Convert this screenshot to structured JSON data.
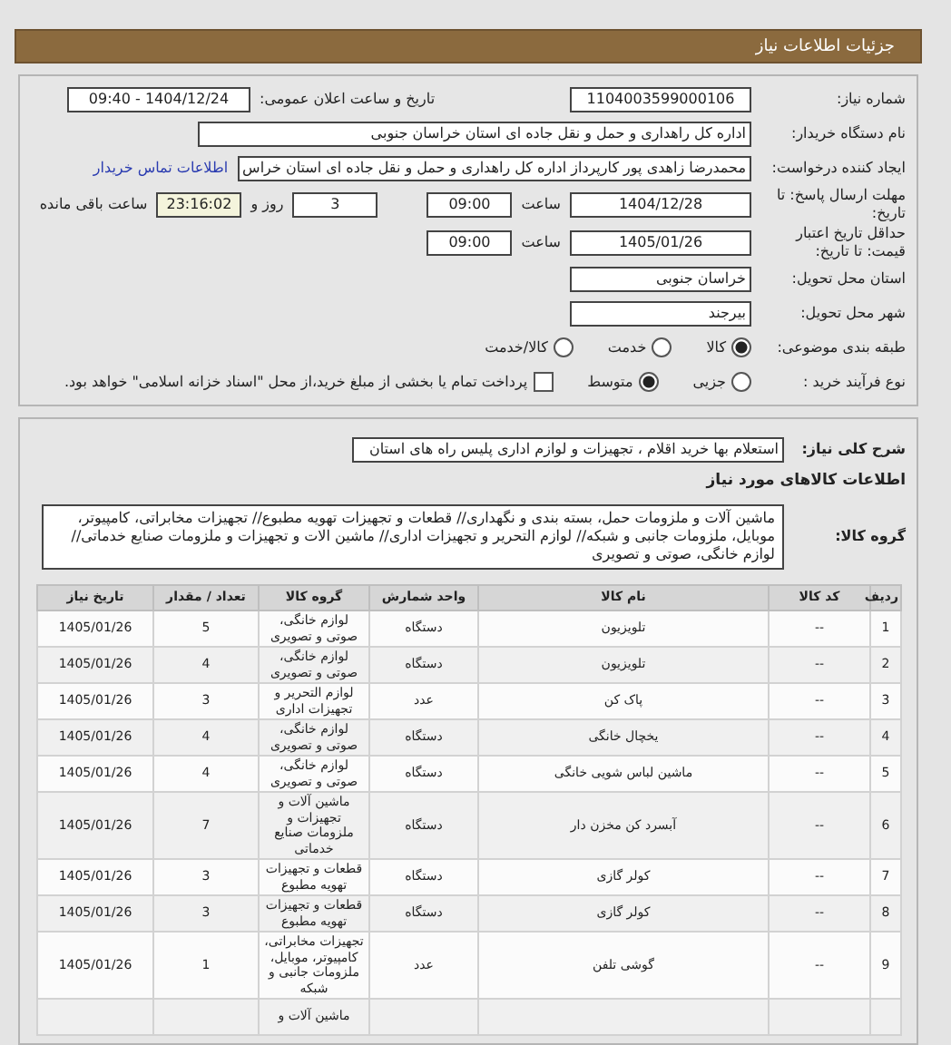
{
  "header": {
    "title": "جزئیات اطلاعات نیاز"
  },
  "details": {
    "need_number": {
      "label": "شماره نیاز:",
      "value": "1104003599000106"
    },
    "announce": {
      "label": "تاریخ و ساعت اعلان عمومی:",
      "value": "1404/12/24 - 09:40"
    },
    "buyer": {
      "label": "نام دستگاه خریدار:",
      "value": "اداره کل راهداری و حمل و نقل جاده ای استان خراسان جنوبی"
    },
    "creator": {
      "label": "ایجاد کننده درخواست:",
      "value": "محمدرضا زاهدی پور کارپرداز اداره کل راهداری و حمل و نقل جاده ای استان خراس",
      "link": "اطلاعات تماس خریدار"
    },
    "deadline": {
      "label": "مهلت ارسال پاسخ: تا تاریخ:",
      "date": "1404/12/28",
      "time_label": "ساعت",
      "time": "09:00",
      "days": "3",
      "days_label": "روز و",
      "remaining": "23:16:02",
      "remaining_label": "ساعت باقی مانده"
    },
    "validity": {
      "label": "حداقل تاریخ اعتبار قیمت: تا تاریخ:",
      "date": "1405/01/26",
      "time_label": "ساعت",
      "time": "09:00"
    },
    "province": {
      "label": "استان محل تحویل:",
      "value": "خراسان جنوبی"
    },
    "city": {
      "label": "شهر محل تحویل:",
      "value": "بیرجند"
    },
    "category": {
      "label": "طبقه بندی موضوعی:",
      "options": [
        {
          "label": "کالا",
          "selected": true
        },
        {
          "label": "خدمت",
          "selected": false
        },
        {
          "label": "کالا/خدمت",
          "selected": false
        }
      ]
    },
    "process": {
      "label": "نوع فرآیند خرید :",
      "options": [
        {
          "label": "جزیی",
          "selected": false
        },
        {
          "label": "متوسط",
          "selected": true
        }
      ],
      "treasury": {
        "checked": false,
        "text": "پرداخت تمام یا بخشی از مبلغ خرید،از محل \"اسناد خزانه اسلامی\" خواهد بود."
      }
    }
  },
  "goods": {
    "description": {
      "label": "شرح کلی نیاز:",
      "value": "استعلام بها خرید اقلام ، تجهیزات و لوازم اداری پلیس راه های استان"
    },
    "heading": "اطلاعات کالاهای مورد نیاز",
    "group": {
      "label": "گروه کالا:",
      "value": "ماشین آلات و ملزومات حمل، بسته بندی و نگهداری// قطعات و تجهیزات تهویه مطبوع// تجهیزات مخابراتی، کامپیوتر، موبایل، ملزومات جانبی و شبکه// لوازم التحریر و تجهیزات اداری// ماشین الات و تجهیزات و ملزومات صنایع خدماتی// لوازم خانگی، صوتی و تصویری"
    },
    "table": {
      "columns": [
        "ردیف",
        "کد کالا",
        "نام کالا",
        "واحد شمارش",
        "گروه کالا",
        "تعداد / مقدار",
        "تاریخ نیاز"
      ],
      "rows": [
        [
          "1",
          "--",
          "تلویزیون",
          "دستگاه",
          "لوازم خانگی، صوتی و تصویری",
          "5",
          "1405/01/26"
        ],
        [
          "2",
          "--",
          "تلویزیون",
          "دستگاه",
          "لوازم خانگی، صوتی و تصویری",
          "4",
          "1405/01/26"
        ],
        [
          "3",
          "--",
          "پاک کن",
          "عدد",
          "لوازم التحریر و تجهیزات اداری",
          "3",
          "1405/01/26"
        ],
        [
          "4",
          "--",
          "یخچال خانگی",
          "دستگاه",
          "لوازم خانگی، صوتی و تصویری",
          "4",
          "1405/01/26"
        ],
        [
          "5",
          "--",
          "ماشین لباس شویی خانگی",
          "دستگاه",
          "لوازم خانگی، صوتی و تصویری",
          "4",
          "1405/01/26"
        ],
        [
          "6",
          "--",
          "آبسرد کن مخزن دار",
          "دستگاه",
          "ماشین آلات و تجهیزات و ملزومات صنایع خدماتی",
          "7",
          "1405/01/26"
        ],
        [
          "7",
          "--",
          "کولر گازی",
          "دستگاه",
          "قطعات و تجهیزات تهویه مطبوع",
          "3",
          "1405/01/26"
        ],
        [
          "8",
          "--",
          "کولر گازی",
          "دستگاه",
          "قطعات و تجهیزات تهویه مطبوع",
          "3",
          "1405/01/26"
        ],
        [
          "9",
          "--",
          "گوشی تلفن",
          "عدد",
          "تجهیزات مخابراتی، کامپیوتر، موبایل، ملزومات جانبی و شبکه",
          "1",
          "1405/01/26"
        ],
        [
          "",
          "",
          "",
          "",
          "ماشین آلات و",
          "",
          ""
        ]
      ]
    }
  }
}
